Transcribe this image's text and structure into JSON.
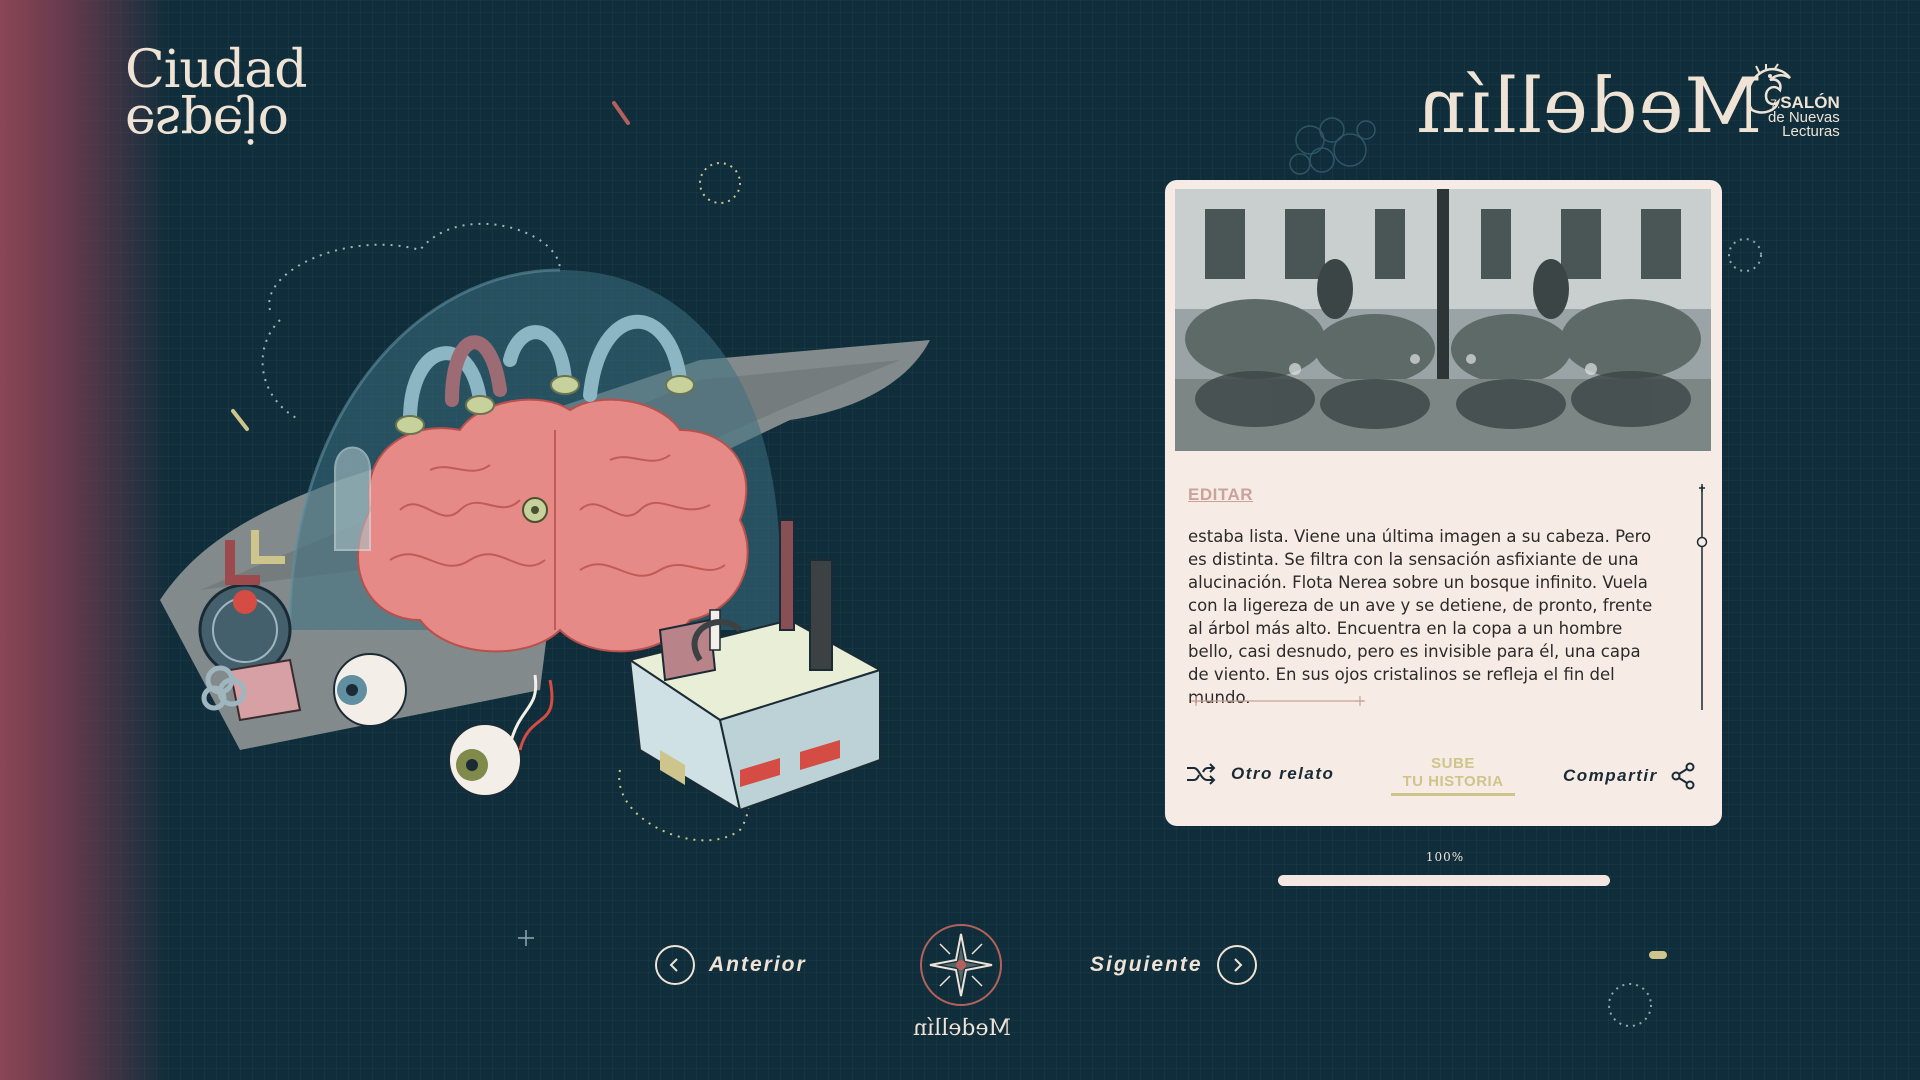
{
  "branding": {
    "logo_line1": "Ciudad",
    "logo_line2": "espejo",
    "city_title": "Medellín",
    "salon": {
      "number": "7.",
      "line1": "SALÓN",
      "line2": "de Nuevas",
      "line3": "Lecturas"
    }
  },
  "card": {
    "edit_label": "EDITAR",
    "story_text": "estaba lista. Viene una última imagen a su cabeza. Pero es distinta. Se filtra con la sensación asfixiante de una alucinación. Flota Nerea sobre un bosque infinito. Vuela con la ligereza de un ave y se detiene, de pronto, frente al árbol más alto. Encuentra en la copa a un hombre bello, casi desnudo, pero es invisible para él, una capa de viento. En sus ojos cristalinos se refleja el fin del mundo.",
    "actions": {
      "other_story": "Otro relato",
      "upload_line1": "SUBE",
      "upload_line2": "TU HISTORIA",
      "share": "Compartir"
    }
  },
  "progress": {
    "label": "100%",
    "value": 1.0
  },
  "navigation": {
    "prev_label": "Anterior",
    "next_label": "Siguiente",
    "compass_caption": "Medellín"
  },
  "icons": {
    "shuffle": "shuffle-icon",
    "share": "share-icon",
    "prev": "chevron-left-icon",
    "next": "chevron-right-icon",
    "compass": "compass-rose-icon"
  },
  "colors": {
    "background": "#0f2d3a",
    "card": "#f6ebe5",
    "accent_rose": "#c9a299",
    "accent_olive": "#cdc58b",
    "cream": "#efe3d6"
  }
}
